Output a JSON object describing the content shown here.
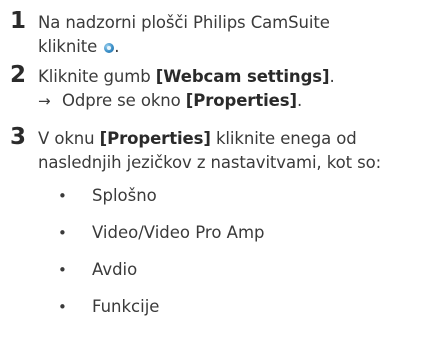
{
  "steps": [
    {
      "number": "1",
      "line1": "Na nadzorni plošči Philips CamSuite",
      "line2_pre": "kliknite ",
      "icon": "camsuite-icon",
      "line2_post": "."
    },
    {
      "number": "2",
      "pre": "Kliknite gumb ",
      "button": "[Webcam settings]",
      "post": ".",
      "arrow": "→",
      "result_pre": "Odpre se okno ",
      "result_window": "[Properties]",
      "result_post": "."
    },
    {
      "number": "3",
      "pre": "V oknu ",
      "window": "[Properties]",
      "post_line1": " kliknite enega od",
      "line2": "naslednjih jezičkov z nastavitvami, kot so:"
    }
  ],
  "bullet_symbol": "•",
  "tabs": [
    "Splošno",
    "Video/Video Pro Amp",
    "Avdio",
    "Funkcije"
  ],
  "colors": {
    "text": "#3a3a3a",
    "number": "#2b2b2b"
  }
}
